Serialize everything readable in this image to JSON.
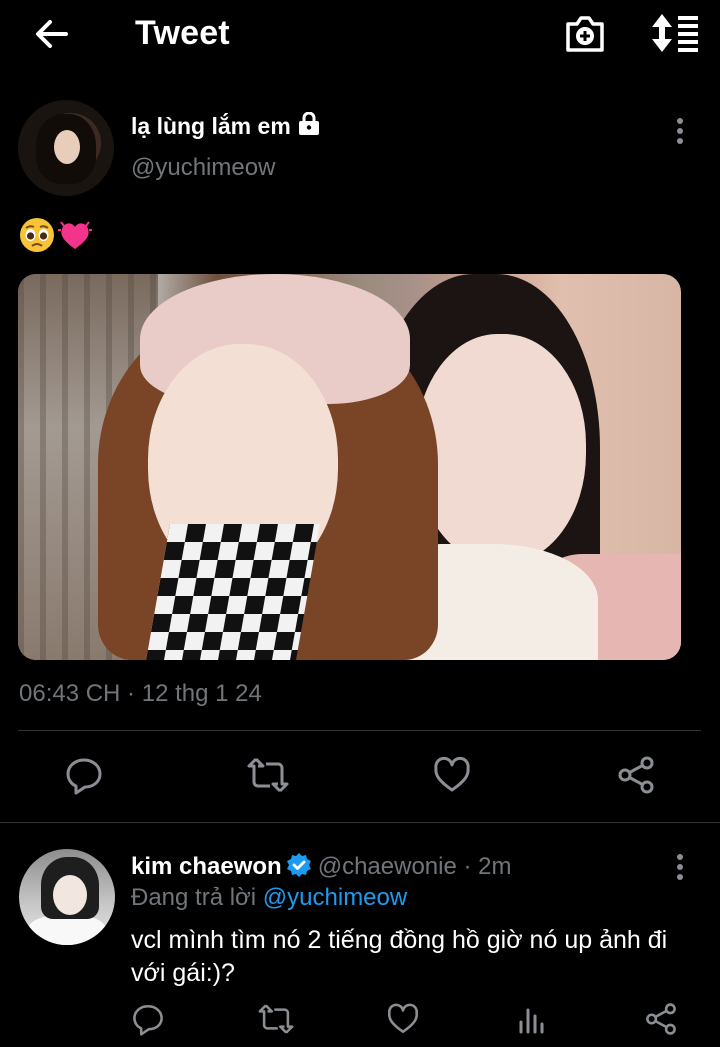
{
  "header": {
    "title": "Tweet"
  },
  "tweet": {
    "author_name": "lạ lùng lắm em",
    "author_handle": "@yuchimeow",
    "emoji_text": "🥺💓",
    "timestamp": "06:43 CH · 12 thg 1 24"
  },
  "reply": {
    "author_name": "kim chaewon",
    "author_handle": "@chaewonie",
    "separator": " · ",
    "age": "2m",
    "replying_prefix": "Đang trả lời ",
    "replying_to": "@yuchimeow",
    "text": "vcl mình tìm nó 2 tiếng đồng hồ giờ nó up ảnh đi với gái:)?"
  },
  "colors": {
    "background": "#000000",
    "text": "#e7e9ea",
    "muted": "#71767b",
    "accent": "#1d9bf0",
    "divider": "#2f3336"
  }
}
